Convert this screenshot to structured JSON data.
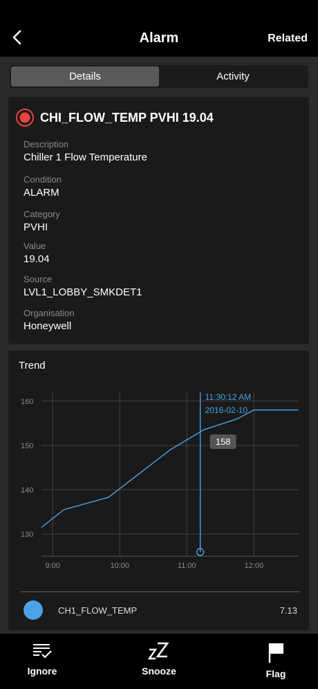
{
  "header": {
    "title": "Alarm",
    "related_label": "Related"
  },
  "tabs": [
    {
      "label": "Details",
      "active": true
    },
    {
      "label": "Activity",
      "active": false
    }
  ],
  "alarm": {
    "title": "CHI_FLOW_TEMP PVHI 19.04",
    "status_color": "#e8453c",
    "fields": [
      {
        "label": "Description",
        "value": "Chiller 1 Flow Temperature"
      },
      {
        "label": "Condition",
        "value": "ALARM"
      },
      {
        "label": "Category",
        "value": "PVHI"
      },
      {
        "label": "Value",
        "value": "19.04"
      },
      {
        "label": "Source",
        "value": "LVL1_LOBBY_SMKDET1"
      },
      {
        "label": "Organisation",
        "value": "Honeywell"
      }
    ]
  },
  "trend": {
    "title": "Trend",
    "legend": {
      "name": "CH1_FLOW_TEMP",
      "value": "7.13",
      "color": "#4aa3e8"
    }
  },
  "chart_data": {
    "type": "line",
    "x_unit": "time of day (2016-02-10)",
    "xlim": [
      "8:50",
      "12:40"
    ],
    "ylim": [
      125,
      162
    ],
    "x_ticks": [
      "9:00",
      "10:00",
      "11:00",
      "12:00"
    ],
    "y_ticks": [
      130,
      140,
      150,
      160
    ],
    "grid": true,
    "series": [
      {
        "name": "CH1_FLOW_TEMP",
        "color": "#4aa3e8",
        "points": [
          {
            "x": "8:50",
            "y": 131.5
          },
          {
            "x": "9:10",
            "y": 135.5
          },
          {
            "x": "9:50",
            "y": 138.3
          },
          {
            "x": "10:45",
            "y": 149
          },
          {
            "x": "11:15",
            "y": 153.5
          },
          {
            "x": "11:45",
            "y": 156
          },
          {
            "x": "12:00",
            "y": 158
          },
          {
            "x": "12:40",
            "y": 158
          }
        ]
      }
    ],
    "cursor": {
      "x": "11:12",
      "time_label": "11:30:12 AM",
      "date_label": "2016-02-10",
      "value_label": "158"
    }
  },
  "actions": [
    {
      "label": "Ignore",
      "icon": "ignore-icon"
    },
    {
      "label": "Snooze",
      "icon": "snooze-icon"
    },
    {
      "label": "Flag",
      "icon": "flag-icon"
    }
  ]
}
